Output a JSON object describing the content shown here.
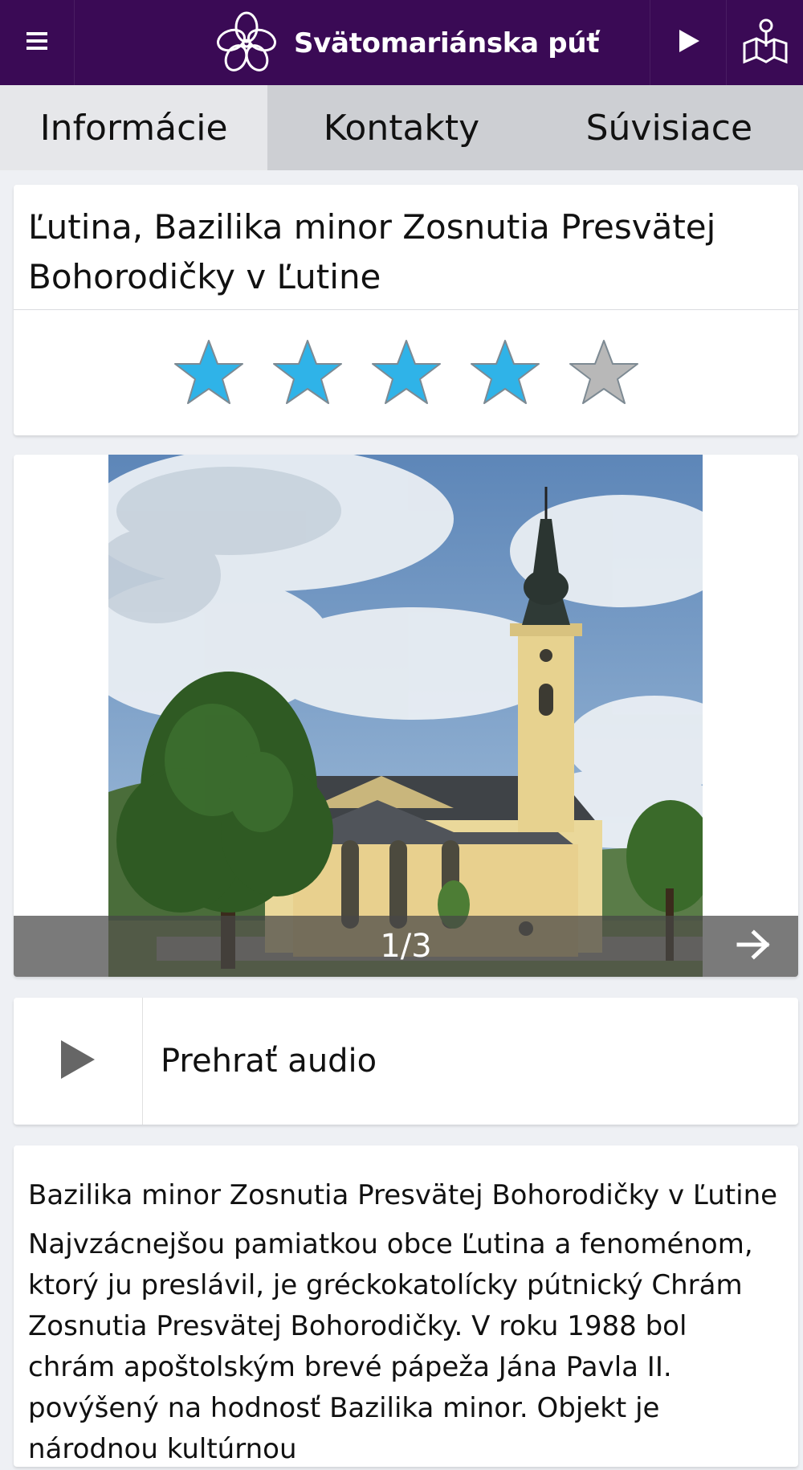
{
  "app": {
    "brand_title": "Svätomariánska púť",
    "colors": {
      "topbar": "#3a0a55",
      "star_active": "#2fb3e8",
      "star_inactive": "#b8b8b8"
    },
    "icons": {
      "menu": "hamburger-icon",
      "play": "play-icon",
      "map": "map-pin-icon",
      "logo": "flower-logo-icon"
    }
  },
  "tabs": [
    {
      "label": "Informácie",
      "active": true
    },
    {
      "label": "Kontakty",
      "active": false
    },
    {
      "label": "Súvisiace",
      "active": false
    }
  ],
  "place": {
    "title": "Ľutina, Bazilika minor Zosnutia Presvätej Bohorodičky v Ľutine",
    "rating": {
      "value": 4,
      "max": 5
    }
  },
  "gallery": {
    "counter": "1/3",
    "current": 1,
    "total": 3
  },
  "audio": {
    "label": "Prehrať audio"
  },
  "description": {
    "heading": "Bazilika minor Zosnutia Presvätej Bohorodičky v Ľutine",
    "body": "Najvzácnejšou pamiatkou obce Ľutina a fenoménom, ktorý ju preslávil, je gréckokatolícky pútnický Chrám Zosnutia Presvätej Bohorodičky. V roku 1988 bol chrám apoštolským brevé pápeža Jána Pavla II. povýšený na hodnosť Bazilika minor. Objekt je národnou kultúrnou"
  }
}
